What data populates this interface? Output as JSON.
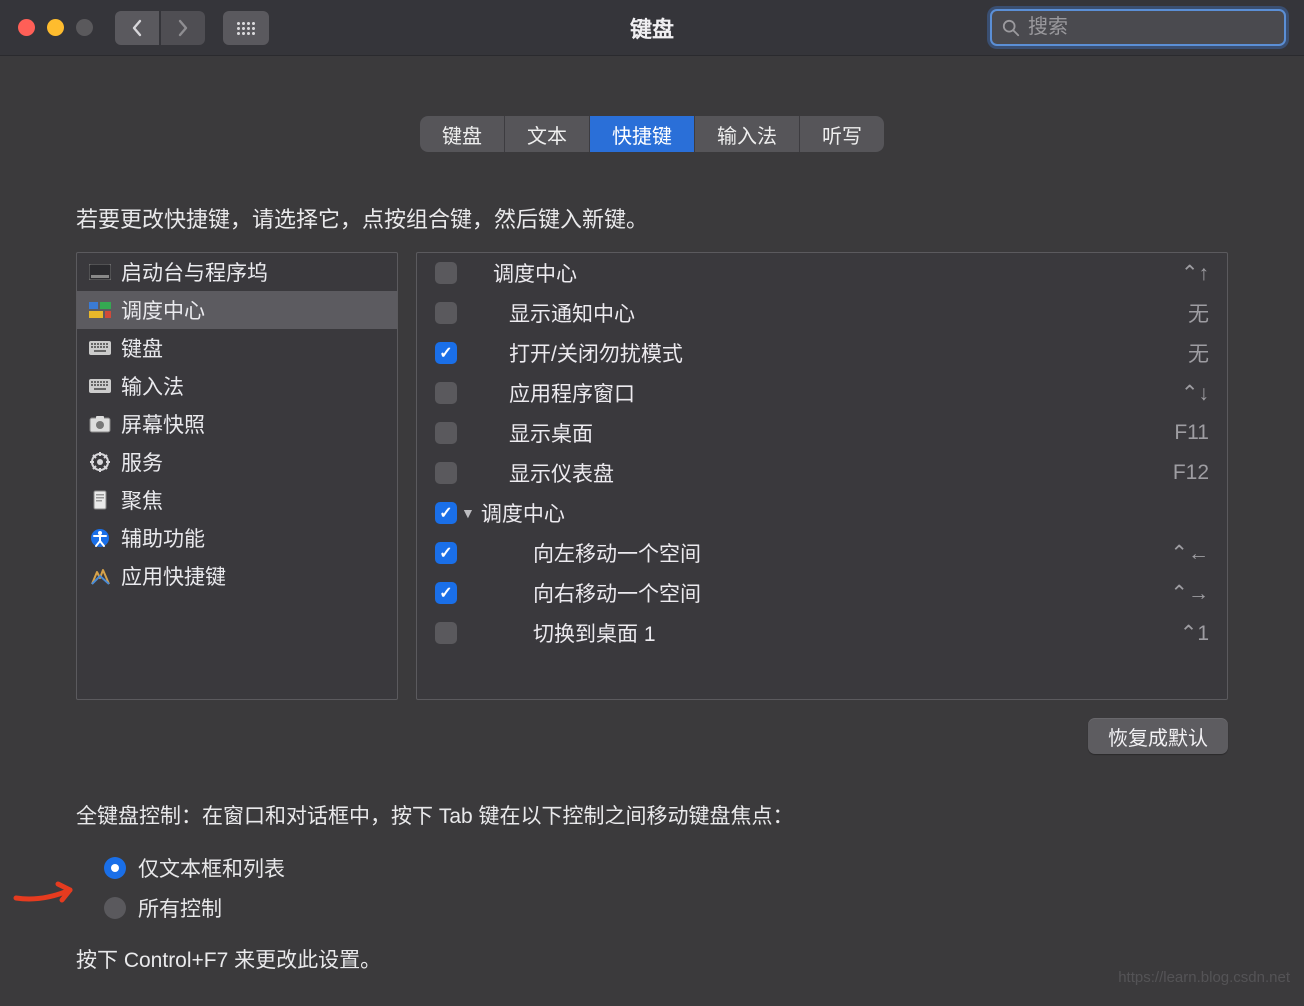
{
  "window": {
    "title": "键盘"
  },
  "search": {
    "placeholder": "搜索"
  },
  "tabs": [
    {
      "label": "键盘",
      "active": false
    },
    {
      "label": "文本",
      "active": false
    },
    {
      "label": "快捷键",
      "active": true
    },
    {
      "label": "输入法",
      "active": false
    },
    {
      "label": "听写",
      "active": false
    }
  ],
  "instruction": "若要更改快捷键，请选择它，点按组合键，然后键入新键。",
  "categories": [
    {
      "label": "启动台与程序坞",
      "icon": "launchpad",
      "selected": false
    },
    {
      "label": "调度中心",
      "icon": "mission",
      "selected": true
    },
    {
      "label": "键盘",
      "icon": "keyboard",
      "selected": false
    },
    {
      "label": "输入法",
      "icon": "keyboard2",
      "selected": false
    },
    {
      "label": "屏幕快照",
      "icon": "screenshot",
      "selected": false
    },
    {
      "label": "服务",
      "icon": "gear",
      "selected": false
    },
    {
      "label": "聚焦",
      "icon": "spotlight",
      "selected": false
    },
    {
      "label": "辅助功能",
      "icon": "accessibility",
      "selected": false
    },
    {
      "label": "应用快捷键",
      "icon": "apps",
      "selected": false
    }
  ],
  "shortcuts": [
    {
      "checked": false,
      "label": "调度中心",
      "shortcut": "⌃↑",
      "indent": 0
    },
    {
      "checked": false,
      "label": "显示通知中心",
      "shortcut": "无",
      "indent": 1
    },
    {
      "checked": true,
      "label": "打开/关闭勿扰模式",
      "shortcut": "无",
      "indent": 1
    },
    {
      "checked": false,
      "label": "应用程序窗口",
      "shortcut": "⌃↓",
      "indent": 1
    },
    {
      "checked": false,
      "label": "显示桌面",
      "shortcut": "F11",
      "indent": 1
    },
    {
      "checked": false,
      "label": "显示仪表盘",
      "shortcut": "F12",
      "indent": 1
    },
    {
      "checked": true,
      "label": "调度中心",
      "shortcut": "",
      "indent": 0,
      "disclosure": true
    },
    {
      "checked": true,
      "label": "向左移动一个空间",
      "shortcut": "⌃←",
      "indent": 2
    },
    {
      "checked": true,
      "label": "向右移动一个空间",
      "shortcut": "⌃→",
      "indent": 2
    },
    {
      "checked": false,
      "label": "切换到桌面 1",
      "shortcut": "⌃1",
      "indent": 2
    }
  ],
  "restore_button": "恢复成默认",
  "full_keyboard_text": "全键盘控制：在窗口和对话框中，按下 Tab 键在以下控制之间移动键盘焦点：",
  "radios": [
    {
      "label": "仅文本框和列表",
      "selected": true
    },
    {
      "label": "所有控制",
      "selected": false
    }
  ],
  "hint": "按下 Control+F7 来更改此设置。",
  "watermark": "https://learn.blog.csdn.net"
}
